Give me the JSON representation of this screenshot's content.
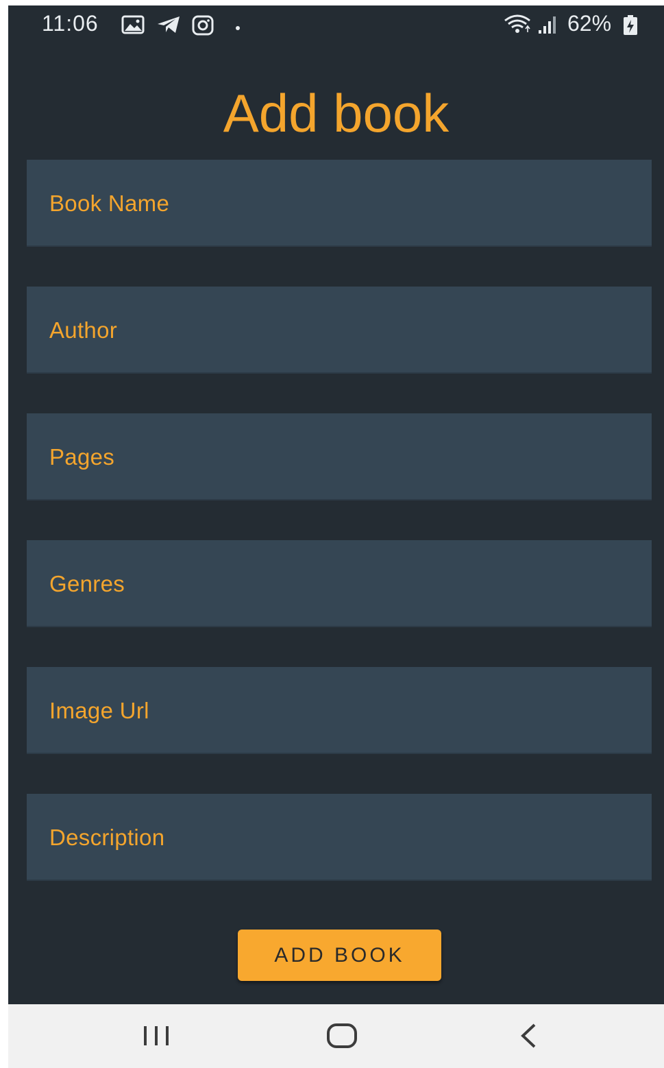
{
  "status_bar": {
    "time": "11:06",
    "battery": "62%",
    "icons": [
      "gallery-icon",
      "telegram-icon",
      "instagram-icon",
      "dot-icon",
      "wifi-icon",
      "signal-icon",
      "battery-charging-icon"
    ]
  },
  "page": {
    "title": "Add book"
  },
  "form": {
    "fields": [
      {
        "placeholder": "Book Name",
        "value": ""
      },
      {
        "placeholder": "Author",
        "value": ""
      },
      {
        "placeholder": "Pages",
        "value": ""
      },
      {
        "placeholder": "Genres",
        "value": ""
      },
      {
        "placeholder": "Image Url",
        "value": ""
      },
      {
        "placeholder": "Description",
        "value": ""
      }
    ],
    "submit_label": "ADD BOOK"
  },
  "nav_bar": {
    "buttons": [
      "recent-apps-icon",
      "home-icon",
      "back-icon"
    ]
  },
  "colors": {
    "background": "#242c33",
    "field_background": "#354654",
    "accent": "#f4a52d",
    "button": "#f8a82f",
    "nav_background": "#f1f1f1"
  }
}
